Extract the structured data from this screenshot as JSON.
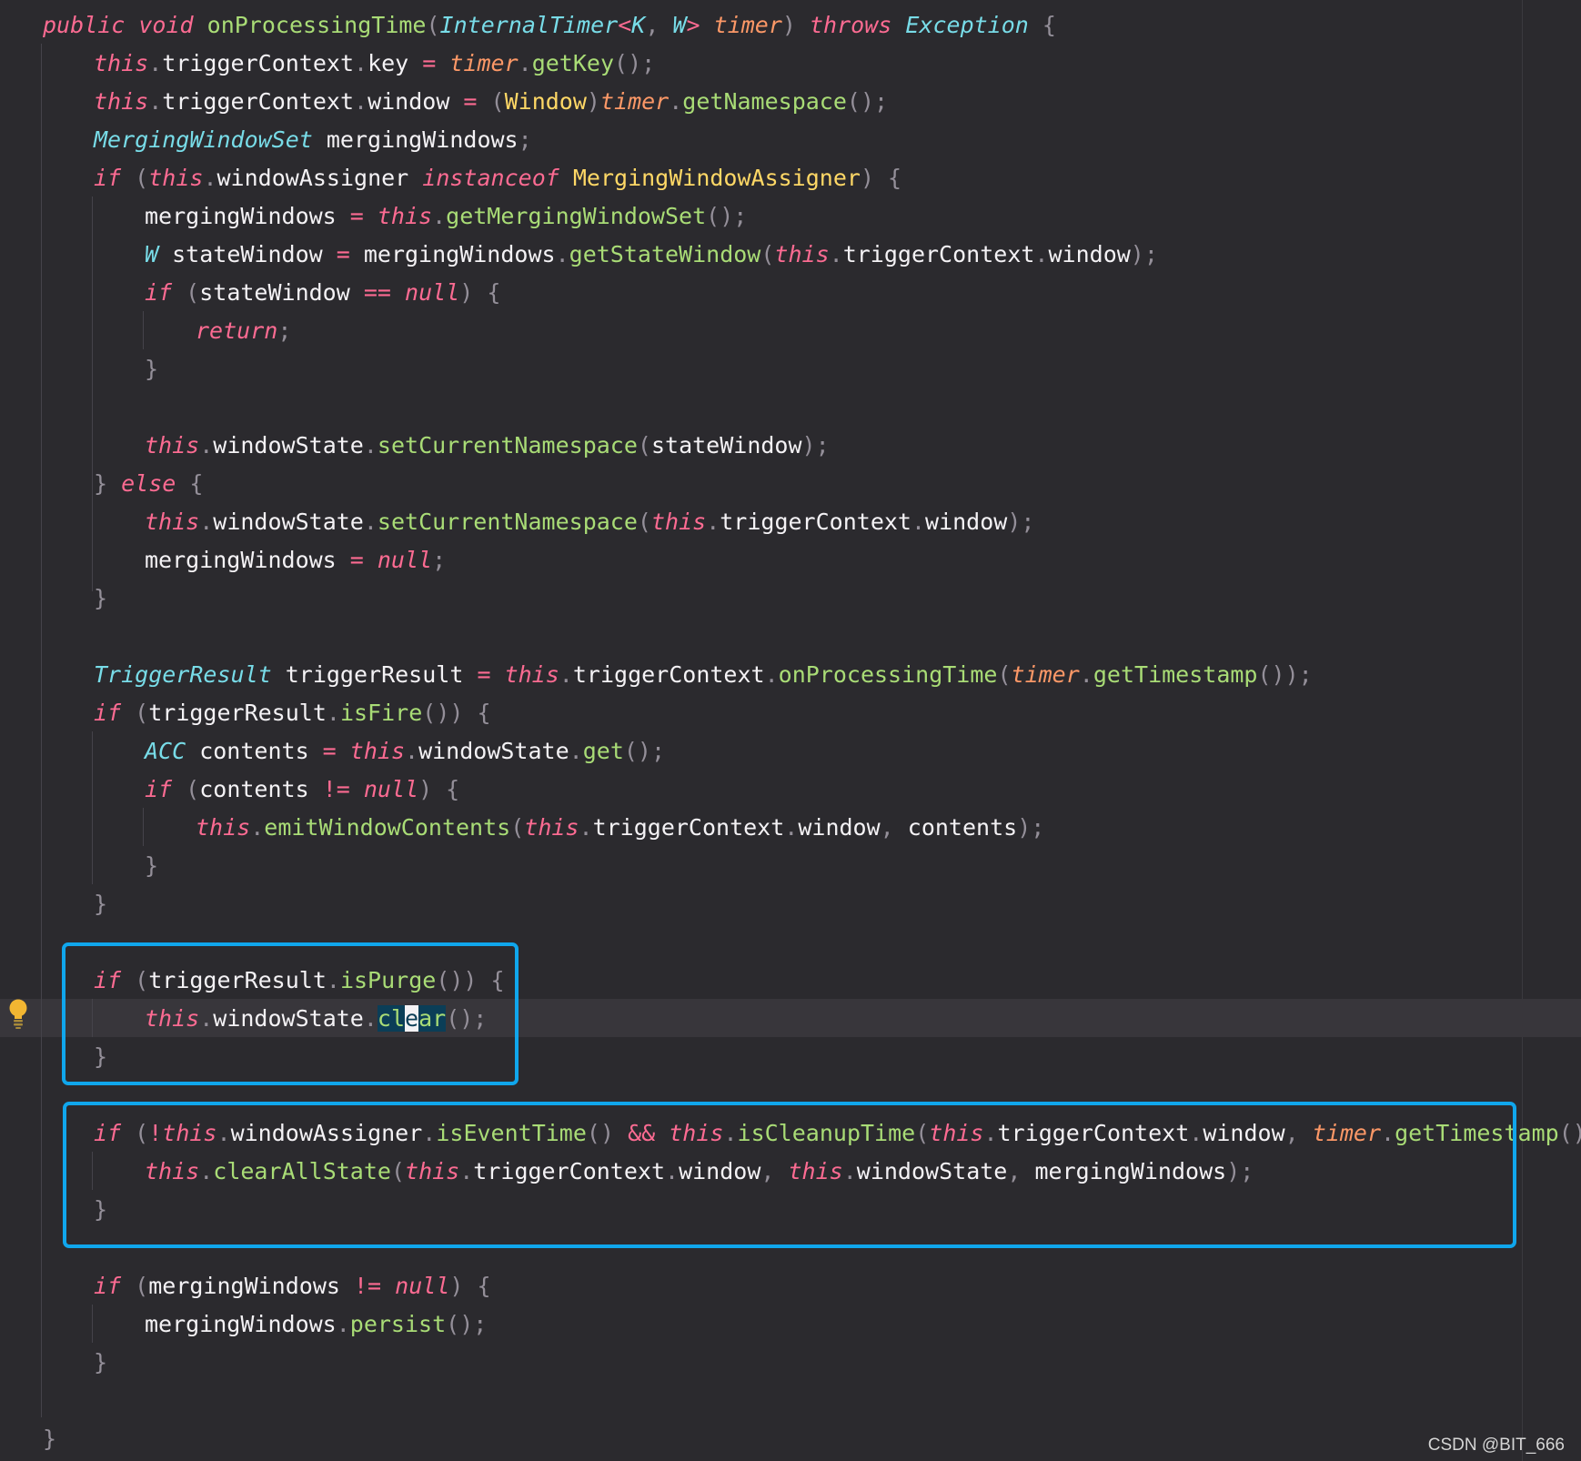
{
  "editor": {
    "theme_colors": {
      "background": "#2b2a2e",
      "keyword": "#fc6b92",
      "type": "#78dce8",
      "class": "#ffd866",
      "function": "#a9dc76",
      "parameter": "#fc9867",
      "identifier": "#f4f2f5",
      "punctuation": "#948f99",
      "highlight_border": "#10a6ec"
    },
    "current_line": 27,
    "lines": [
      {
        "indent": 0,
        "tokens": [
          [
            "public",
            "kw"
          ],
          [
            " ",
            "id"
          ],
          [
            "void",
            "kw"
          ],
          [
            " ",
            "id"
          ],
          [
            "onProcessingTime",
            "fn"
          ],
          [
            "(",
            "punc"
          ],
          [
            "InternalTimer",
            "type"
          ],
          [
            "<",
            "op"
          ],
          [
            "K",
            "type"
          ],
          [
            ", ",
            "punc"
          ],
          [
            "W",
            "type"
          ],
          [
            "> ",
            "op"
          ],
          [
            "timer",
            "param"
          ],
          [
            ") ",
            "punc"
          ],
          [
            "throws",
            "kw"
          ],
          [
            " ",
            "id"
          ],
          [
            "Exception",
            "type"
          ],
          [
            " {",
            "punc"
          ]
        ]
      },
      {
        "indent": 1,
        "tokens": [
          [
            "this",
            "kw"
          ],
          [
            ".",
            "punc"
          ],
          [
            "triggerContext",
            "id"
          ],
          [
            ".",
            "punc"
          ],
          [
            "key",
            "id"
          ],
          [
            " = ",
            "op"
          ],
          [
            "timer",
            "param"
          ],
          [
            ".",
            "punc"
          ],
          [
            "getKey",
            "fn"
          ],
          [
            "();",
            "punc"
          ]
        ]
      },
      {
        "indent": 1,
        "tokens": [
          [
            "this",
            "kw"
          ],
          [
            ".",
            "punc"
          ],
          [
            "triggerContext",
            "id"
          ],
          [
            ".",
            "punc"
          ],
          [
            "window",
            "id"
          ],
          [
            " = ",
            "op"
          ],
          [
            "(",
            "punc"
          ],
          [
            "Window",
            "cls"
          ],
          [
            ")",
            "punc"
          ],
          [
            "timer",
            "param"
          ],
          [
            ".",
            "punc"
          ],
          [
            "getNamespace",
            "fn"
          ],
          [
            "();",
            "punc"
          ]
        ]
      },
      {
        "indent": 1,
        "tokens": [
          [
            "MergingWindowSet",
            "type"
          ],
          [
            " mergingWindows",
            "id"
          ],
          [
            ";",
            "punc"
          ]
        ]
      },
      {
        "indent": 1,
        "tokens": [
          [
            "if",
            "kw"
          ],
          [
            " (",
            "punc"
          ],
          [
            "this",
            "kw"
          ],
          [
            ".",
            "punc"
          ],
          [
            "windowAssigner",
            "id"
          ],
          [
            " ",
            "id"
          ],
          [
            "instanceof",
            "kw"
          ],
          [
            " ",
            "id"
          ],
          [
            "MergingWindowAssigner",
            "cls"
          ],
          [
            ") {",
            "punc"
          ]
        ]
      },
      {
        "indent": 2,
        "tokens": [
          [
            "mergingWindows",
            "id"
          ],
          [
            " = ",
            "op"
          ],
          [
            "this",
            "kw"
          ],
          [
            ".",
            "punc"
          ],
          [
            "getMergingWindowSet",
            "fn"
          ],
          [
            "();",
            "punc"
          ]
        ]
      },
      {
        "indent": 2,
        "tokens": [
          [
            "W",
            "type"
          ],
          [
            " stateWindow ",
            "id"
          ],
          [
            "=",
            "op"
          ],
          [
            " mergingWindows",
            "id"
          ],
          [
            ".",
            "punc"
          ],
          [
            "getStateWindow",
            "fn"
          ],
          [
            "(",
            "punc"
          ],
          [
            "this",
            "kw"
          ],
          [
            ".",
            "punc"
          ],
          [
            "triggerContext",
            "id"
          ],
          [
            ".",
            "punc"
          ],
          [
            "window",
            "id"
          ],
          [
            ");",
            "punc"
          ]
        ]
      },
      {
        "indent": 2,
        "tokens": [
          [
            "if",
            "kw"
          ],
          [
            " (",
            "punc"
          ],
          [
            "stateWindow ",
            "id"
          ],
          [
            "==",
            "op"
          ],
          [
            " ",
            "id"
          ],
          [
            "null",
            "kw"
          ],
          [
            ") {",
            "punc"
          ]
        ]
      },
      {
        "indent": 3,
        "tokens": [
          [
            "return",
            "kw"
          ],
          [
            ";",
            "punc"
          ]
        ]
      },
      {
        "indent": 2,
        "tokens": [
          [
            "}",
            "punc"
          ]
        ]
      },
      {
        "indent": 0,
        "tokens": []
      },
      {
        "indent": 2,
        "tokens": [
          [
            "this",
            "kw"
          ],
          [
            ".",
            "punc"
          ],
          [
            "windowState",
            "id"
          ],
          [
            ".",
            "punc"
          ],
          [
            "setCurrentNamespace",
            "fn"
          ],
          [
            "(",
            "punc"
          ],
          [
            "stateWindow",
            "id"
          ],
          [
            ");",
            "punc"
          ]
        ]
      },
      {
        "indent": 1,
        "tokens": [
          [
            "} ",
            "punc"
          ],
          [
            "else",
            "kw"
          ],
          [
            " {",
            "punc"
          ]
        ]
      },
      {
        "indent": 2,
        "tokens": [
          [
            "this",
            "kw"
          ],
          [
            ".",
            "punc"
          ],
          [
            "windowState",
            "id"
          ],
          [
            ".",
            "punc"
          ],
          [
            "setCurrentNamespace",
            "fn"
          ],
          [
            "(",
            "punc"
          ],
          [
            "this",
            "kw"
          ],
          [
            ".",
            "punc"
          ],
          [
            "triggerContext",
            "id"
          ],
          [
            ".",
            "punc"
          ],
          [
            "window",
            "id"
          ],
          [
            ");",
            "punc"
          ]
        ]
      },
      {
        "indent": 2,
        "tokens": [
          [
            "mergingWindows",
            "id"
          ],
          [
            " = ",
            "op"
          ],
          [
            "null",
            "kw"
          ],
          [
            ";",
            "punc"
          ]
        ]
      },
      {
        "indent": 1,
        "tokens": [
          [
            "}",
            "punc"
          ]
        ]
      },
      {
        "indent": 0,
        "tokens": []
      },
      {
        "indent": 1,
        "tokens": [
          [
            "TriggerResult",
            "type"
          ],
          [
            " triggerResult ",
            "id"
          ],
          [
            "=",
            "op"
          ],
          [
            " ",
            "id"
          ],
          [
            "this",
            "kw"
          ],
          [
            ".",
            "punc"
          ],
          [
            "triggerContext",
            "id"
          ],
          [
            ".",
            "punc"
          ],
          [
            "onProcessingTime",
            "fn"
          ],
          [
            "(",
            "punc"
          ],
          [
            "timer",
            "param"
          ],
          [
            ".",
            "punc"
          ],
          [
            "getTimestamp",
            "fn"
          ],
          [
            "());",
            "punc"
          ]
        ]
      },
      {
        "indent": 1,
        "tokens": [
          [
            "if",
            "kw"
          ],
          [
            " (",
            "punc"
          ],
          [
            "triggerResult",
            "id"
          ],
          [
            ".",
            "punc"
          ],
          [
            "isFire",
            "fn"
          ],
          [
            "()) {",
            "punc"
          ]
        ]
      },
      {
        "indent": 2,
        "tokens": [
          [
            "ACC",
            "type"
          ],
          [
            " contents ",
            "id"
          ],
          [
            "=",
            "op"
          ],
          [
            " ",
            "id"
          ],
          [
            "this",
            "kw"
          ],
          [
            ".",
            "punc"
          ],
          [
            "windowState",
            "id"
          ],
          [
            ".",
            "punc"
          ],
          [
            "get",
            "fn"
          ],
          [
            "();",
            "punc"
          ]
        ]
      },
      {
        "indent": 2,
        "tokens": [
          [
            "if",
            "kw"
          ],
          [
            " (",
            "punc"
          ],
          [
            "contents ",
            "id"
          ],
          [
            "!=",
            "op"
          ],
          [
            " ",
            "id"
          ],
          [
            "null",
            "kw"
          ],
          [
            ") {",
            "punc"
          ]
        ]
      },
      {
        "indent": 3,
        "tokens": [
          [
            "this",
            "kw"
          ],
          [
            ".",
            "punc"
          ],
          [
            "emitWindowContents",
            "fn"
          ],
          [
            "(",
            "punc"
          ],
          [
            "this",
            "kw"
          ],
          [
            ".",
            "punc"
          ],
          [
            "triggerContext",
            "id"
          ],
          [
            ".",
            "punc"
          ],
          [
            "window",
            "id"
          ],
          [
            ", ",
            "punc"
          ],
          [
            "contents",
            "id"
          ],
          [
            ");",
            "punc"
          ]
        ]
      },
      {
        "indent": 2,
        "tokens": [
          [
            "}",
            "punc"
          ]
        ]
      },
      {
        "indent": 1,
        "tokens": [
          [
            "}",
            "punc"
          ]
        ]
      },
      {
        "indent": 0,
        "tokens": []
      },
      {
        "indent": 1,
        "tokens": [
          [
            "if",
            "kw"
          ],
          [
            " (",
            "punc"
          ],
          [
            "triggerResult",
            "id"
          ],
          [
            ".",
            "punc"
          ],
          [
            "isPurge",
            "fn"
          ],
          [
            "()) {",
            "punc"
          ]
        ]
      },
      {
        "indent": 2,
        "tokens": [
          [
            "this",
            "kw"
          ],
          [
            ".",
            "punc"
          ],
          [
            "windowState",
            "id"
          ],
          [
            ".",
            "punc"
          ],
          [
            "cl",
            "hl-sel"
          ],
          [
            "e",
            "hl-caret"
          ],
          [
            "ar",
            "hl-sel"
          ],
          [
            "();",
            "punc"
          ]
        ]
      },
      {
        "indent": 1,
        "tokens": [
          [
            "}",
            "punc"
          ]
        ]
      },
      {
        "indent": 0,
        "tokens": []
      },
      {
        "indent": 1,
        "tokens": [
          [
            "if",
            "kw"
          ],
          [
            " (",
            "punc"
          ],
          [
            "!",
            "op"
          ],
          [
            "this",
            "kw"
          ],
          [
            ".",
            "punc"
          ],
          [
            "windowAssigner",
            "id"
          ],
          [
            ".",
            "punc"
          ],
          [
            "isEventTime",
            "fn"
          ],
          [
            "() ",
            "punc"
          ],
          [
            "&&",
            "op"
          ],
          [
            " ",
            "id"
          ],
          [
            "this",
            "kw"
          ],
          [
            ".",
            "punc"
          ],
          [
            "isCleanupTime",
            "fn"
          ],
          [
            "(",
            "punc"
          ],
          [
            "this",
            "kw"
          ],
          [
            ".",
            "punc"
          ],
          [
            "triggerContext",
            "id"
          ],
          [
            ".",
            "punc"
          ],
          [
            "window",
            "id"
          ],
          [
            ", ",
            "punc"
          ],
          [
            "timer",
            "param"
          ],
          [
            ".",
            "punc"
          ],
          [
            "getTimestamp",
            "fn"
          ],
          [
            "())) {",
            "punc"
          ]
        ]
      },
      {
        "indent": 2,
        "tokens": [
          [
            "this",
            "kw"
          ],
          [
            ".",
            "punc"
          ],
          [
            "clearAllState",
            "fn"
          ],
          [
            "(",
            "punc"
          ],
          [
            "this",
            "kw"
          ],
          [
            ".",
            "punc"
          ],
          [
            "triggerContext",
            "id"
          ],
          [
            ".",
            "punc"
          ],
          [
            "window",
            "id"
          ],
          [
            ", ",
            "punc"
          ],
          [
            "this",
            "kw"
          ],
          [
            ".",
            "punc"
          ],
          [
            "windowState",
            "id"
          ],
          [
            ", ",
            "punc"
          ],
          [
            "mergingWindows",
            "id"
          ],
          [
            ");",
            "punc"
          ]
        ]
      },
      {
        "indent": 1,
        "tokens": [
          [
            "}",
            "punc"
          ]
        ]
      },
      {
        "indent": 0,
        "tokens": []
      },
      {
        "indent": 1,
        "tokens": [
          [
            "if",
            "kw"
          ],
          [
            " (",
            "punc"
          ],
          [
            "mergingWindows ",
            "id"
          ],
          [
            "!=",
            "op"
          ],
          [
            " ",
            "id"
          ],
          [
            "null",
            "kw"
          ],
          [
            ") {",
            "punc"
          ]
        ]
      },
      {
        "indent": 2,
        "tokens": [
          [
            "mergingWindows",
            "id"
          ],
          [
            ".",
            "punc"
          ],
          [
            "persist",
            "fn"
          ],
          [
            "();",
            "punc"
          ]
        ]
      },
      {
        "indent": 1,
        "tokens": [
          [
            "}",
            "punc"
          ]
        ]
      },
      {
        "indent": 0,
        "tokens": []
      },
      {
        "indent": 0,
        "tokens": [
          [
            "}",
            "punc"
          ]
        ]
      }
    ]
  },
  "gutter": {
    "intention_icon": "lightbulb-icon"
  },
  "watermark": {
    "text": "CSDN @BIT_666"
  }
}
